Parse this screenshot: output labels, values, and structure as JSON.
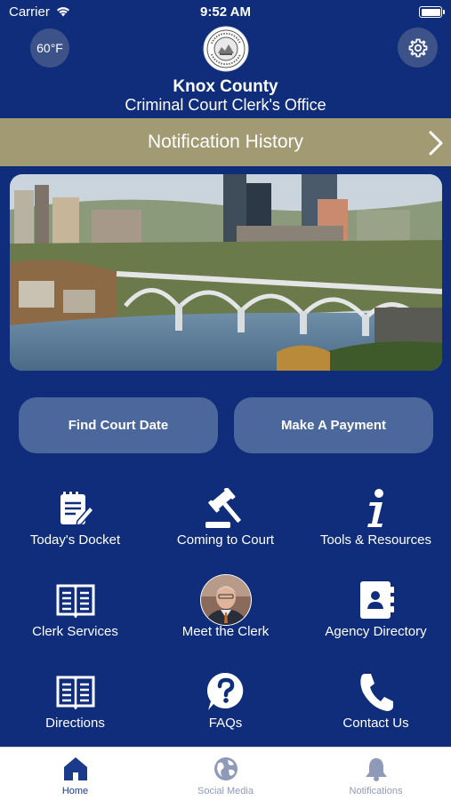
{
  "status_bar": {
    "carrier": "Carrier",
    "time": "9:52 AM",
    "battery_level": 1.0
  },
  "header": {
    "temperature": "60°F",
    "seal_icon": "county-seal-icon",
    "county_name": "Knox County",
    "office_name": "Criminal Court Clerk's Office",
    "settings_icon": "gear-icon"
  },
  "notification_bar": {
    "label": "Notification History",
    "chevron_icon": "chevron-right-icon"
  },
  "hero": {
    "subject": "city-skyline-with-bridge"
  },
  "primary_actions": {
    "find_court_date": "Find Court Date",
    "make_payment": "Make A Payment"
  },
  "menu": [
    {
      "label": "Today's Docket",
      "icon": "docket-icon"
    },
    {
      "label": "Coming to Court",
      "icon": "gavel-icon"
    },
    {
      "label": "Tools & Resources",
      "icon": "info-icon"
    },
    {
      "label": "Clerk Services",
      "icon": "book-icon"
    },
    {
      "label": "Meet the Clerk",
      "icon": "clerk-avatar"
    },
    {
      "label": "Agency Directory",
      "icon": "address-book-icon"
    },
    {
      "label": "Directions",
      "icon": "book-icon"
    },
    {
      "label": "FAQs",
      "icon": "question-icon"
    },
    {
      "label": "Contact Us",
      "icon": "phone-icon"
    }
  ],
  "tab_bar": {
    "tabs": [
      {
        "label": "Home",
        "icon": "home-icon",
        "active": true
      },
      {
        "label": "Social Media",
        "icon": "globe-icon",
        "active": false
      },
      {
        "label": "Notifications",
        "icon": "bell-icon",
        "active": false
      }
    ]
  },
  "colors": {
    "background": "#0f2d7a",
    "gold_bar": "#a19a73",
    "pill": "#4b679b",
    "tab_active": "#1b3a8a",
    "tab_inactive": "#8e9ab8"
  }
}
